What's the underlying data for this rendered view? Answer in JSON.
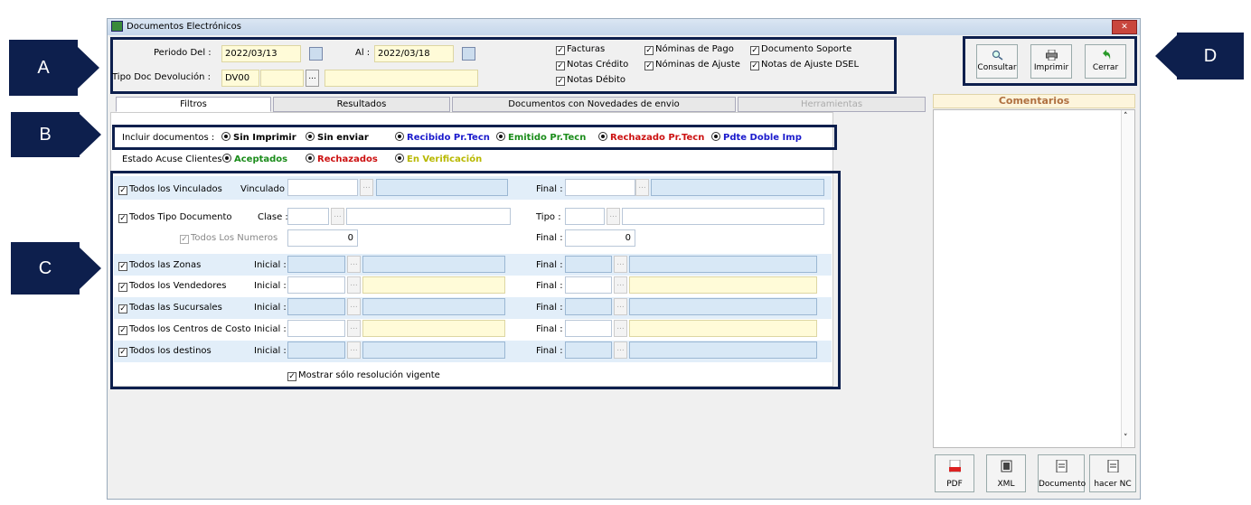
{
  "window": {
    "title": "Documentos Electrónicos",
    "close_label": "✕"
  },
  "periodo": {
    "label_del": "Periodo  Del :",
    "from": "2022/03/13",
    "label_al": "Al :",
    "to": "2022/03/18"
  },
  "tipo_doc": {
    "label": "Tipo Doc Devolución :",
    "value": "DV00"
  },
  "doc_checks": [
    "Facturas",
    "Notas Crédito",
    "Notas Débito",
    "Nóminas de Pago",
    "Nóminas de Ajuste",
    "Documento Soporte",
    "Notas de Ajuste DSEL"
  ],
  "toolbar": {
    "consultar": "Consultar",
    "imprimir": "Imprimir",
    "cerrar": "Cerrar"
  },
  "tabs": [
    "Filtros",
    "Resultados",
    "Documentos con Novedades de envio",
    "Herramientas"
  ],
  "incluir": {
    "label": "Incluir documentos :",
    "options": [
      "Sin Imprimir",
      "Sin enviar",
      "Recibido Pr.Tecn",
      "Emitido Pr.Tecn",
      "Rechazado Pr.Tecn",
      "Pdte Doble Imp"
    ]
  },
  "estado": {
    "label": "Estado Acuse Clientes :",
    "options": [
      "Aceptados",
      "Rechazados",
      "En Verificación"
    ]
  },
  "filters": {
    "vinculados": {
      "check": "Todos los Vinculados",
      "label": "Vinculado :",
      "final": "Final :"
    },
    "tipo_documento": {
      "check": "Todos Tipo Documento",
      "clase": "Clase :",
      "tipo": "Tipo :",
      "numeros": "Todos Los Numeros",
      "num_value": "0",
      "final": "Final :",
      "final_value": "0"
    },
    "zonas": {
      "check": "Todos las Zonas",
      "inicial": "Inicial :",
      "final": "Final :"
    },
    "vendedores": {
      "check": "Todos los Vendedores",
      "inicial": "Inicial :",
      "final": "Final :"
    },
    "sucursales": {
      "check": "Todas las Sucursales",
      "inicial": "Inicial :",
      "final": "Final :"
    },
    "centros": {
      "check": "Todos los Centros de Costo",
      "inicial": "Inicial :",
      "final": "Final :"
    },
    "destinos": {
      "check": "Todos los destinos",
      "inicial": "Inicial :",
      "final": "Final :"
    },
    "resolucion": "Mostrar sólo resolución vigente"
  },
  "comentarios": {
    "title": "Comentarios"
  },
  "bottom_buttons": [
    "PDF",
    "XML",
    "Documento",
    "hacer NC"
  ],
  "callouts": [
    "A",
    "B",
    "C",
    "D"
  ],
  "colors": {
    "frame": "#0d1f4d",
    "green": "#1a8c1a",
    "red": "#cc1111",
    "blue": "#1a1acc",
    "yellow": "#b8b800",
    "comentarios": "#b07040"
  }
}
